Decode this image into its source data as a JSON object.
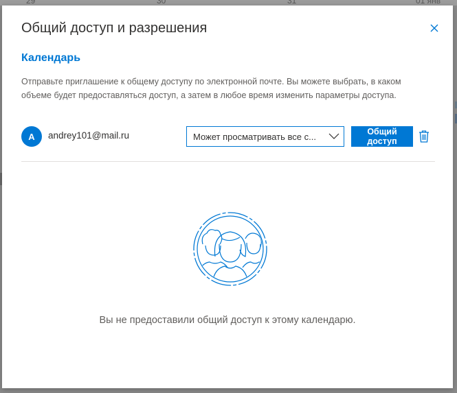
{
  "background": {
    "dates": [
      "29",
      "30",
      "31",
      "01 янв"
    ]
  },
  "dialog": {
    "title": "Общий доступ и разрешения",
    "close_icon": "close-icon",
    "section_title": "Календарь",
    "description": "Отправьте приглашение к общему доступу по электронной почте. Вы можете выбрать, в каком объеме будет предоставляться доступ, а затем в любое время изменить параметры доступа.",
    "recipient": {
      "avatar_initial": "A",
      "email": "andrey101@mail.ru",
      "permission_selected": "Может просматривать все с...",
      "share_button_line1": "Общий",
      "share_button_line2": "доступ",
      "delete_icon": "trash-icon"
    },
    "empty_state": {
      "illustration_icon": "people-circle-icon",
      "message": "Вы не предоставили общий доступ к этому календарю."
    }
  },
  "colors": {
    "accent": "#0078d4",
    "text_primary": "#323130",
    "text_secondary": "#605e5c",
    "divider": "#e1dfdd"
  }
}
